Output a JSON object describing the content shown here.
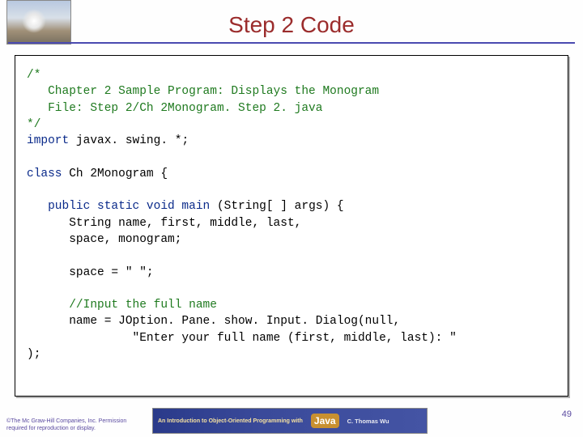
{
  "header": {
    "title": "Step 2 Code"
  },
  "code": {
    "c1": "/*",
    "c2": "   Chapter 2 Sample Program: Displays the Monogram",
    "c3": "   File: Step 2/Ch 2Monogram. Step 2. java",
    "c4": "*/",
    "kw_import": "import ",
    "import_pkg": "javax. swing. *;",
    "kw_class": "class ",
    "class_name": "Ch 2Monogram {",
    "kw_method": "   public static void main ",
    "method_sig": "(String[ ] args) {",
    "decl1": "      String name, first, middle, last,",
    "decl2": "      space, monogram;",
    "space_assign": "      space = \" \";",
    "cm_input": "      //Input the full name",
    "name_assign1": "      name = JOption. Pane. show. Input. Dialog(null,",
    "name_assign2": "               \"Enter your full name (first, middle, last): \"",
    "close": ");"
  },
  "footer": {
    "copyright_line1": "©The Mc Graw-Hill Companies, Inc. Permission",
    "copyright_line2": "required for reproduction or display.",
    "banner_intro": "An Introduction to\nObject-Oriented\nProgramming with",
    "banner_lang": "Java",
    "banner_author": "C. Thomas Wu",
    "page": "49"
  }
}
